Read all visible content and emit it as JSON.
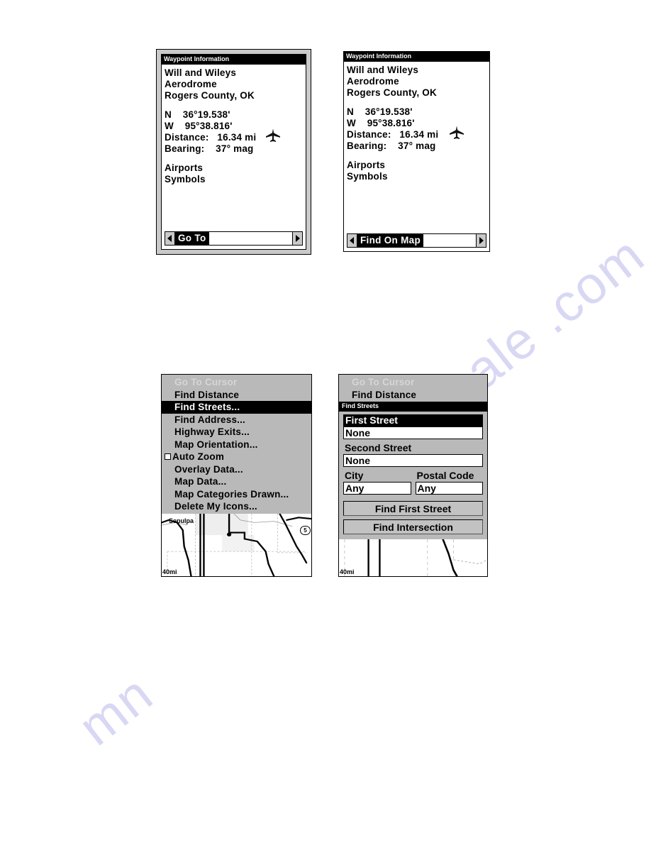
{
  "watermarks": [
    "alsale .com",
    "mn"
  ],
  "panels": {
    "waypoint_goto": {
      "title": "Waypoint Information",
      "lines": [
        "Will and Wileys",
        "Aerodrome",
        "Rogers County, OK"
      ],
      "coord_north": "N    36°19.538'",
      "coord_west": "W    95°38.816'",
      "distance": "Distance:   16.34 mi",
      "bearing": "Bearing:    37° mag",
      "category": "Airports",
      "subcategory": "Symbols",
      "icon": "airplane-icon",
      "selector": {
        "label": "Go To",
        "left_arrow": "left-arrow-icon",
        "right_arrow": "right-arrow-icon"
      }
    },
    "waypoint_findonmap": {
      "title": "Waypoint Information",
      "lines": [
        "Will and Wileys",
        "Aerodrome",
        "Rogers County, OK"
      ],
      "coord_north": "N    36°19.538'",
      "coord_west": "W    95°38.816'",
      "distance": "Distance:   16.34 mi",
      "bearing": "Bearing:    37° mag",
      "category": "Airports",
      "subcategory": "Symbols",
      "icon": "airplane-icon",
      "selector": {
        "label": "Find On Map",
        "left_arrow": "left-arrow-icon",
        "right_arrow": "right-arrow-icon"
      }
    },
    "map_menu": {
      "items": [
        {
          "label": "Go To Cursor",
          "state": "disabled"
        },
        {
          "label": "Find Distance",
          "state": "normal"
        },
        {
          "label": "Find Streets...",
          "state": "selected"
        },
        {
          "label": "Find Address...",
          "state": "normal"
        },
        {
          "label": "Highway Exits...",
          "state": "normal"
        },
        {
          "label": "Map Orientation...",
          "state": "normal"
        },
        {
          "label": "Auto Zoom",
          "state": "checkbox",
          "checked": false
        },
        {
          "label": "Overlay Data...",
          "state": "normal"
        },
        {
          "label": "Map Data...",
          "state": "normal"
        },
        {
          "label": "Map Categories Drawn...",
          "state": "normal"
        },
        {
          "label": "Delete My Icons...",
          "state": "normal"
        }
      ],
      "map": {
        "scale": "40mi",
        "city": "Sepulpa",
        "highway_shield": "5"
      }
    },
    "find_streets": {
      "menu_behind": [
        {
          "label": "Go To Cursor",
          "state": "disabled"
        },
        {
          "label": "Find Distance",
          "state": "normal"
        }
      ],
      "title": "Find Streets",
      "fields": {
        "first_street_label": "First Street",
        "first_street_value": "None",
        "second_street_label": "Second Street",
        "second_street_value": "None",
        "city_label": "City",
        "city_value": "Any",
        "postal_label": "Postal Code",
        "postal_value": "Any"
      },
      "buttons": {
        "find_first_street": "Find First Street",
        "find_intersection": "Find Intersection"
      },
      "map": {
        "scale": "40mi"
      }
    }
  },
  "colors": {
    "screen_bg": "#ffffff",
    "menu_bg": "#b9b9b9",
    "bezel": "#c9c9c9",
    "highlight_bg": "#000000",
    "highlight_fg": "#ffffff",
    "disabled_fg": "#d6d6d6",
    "watermark": "#d8d8f4"
  }
}
